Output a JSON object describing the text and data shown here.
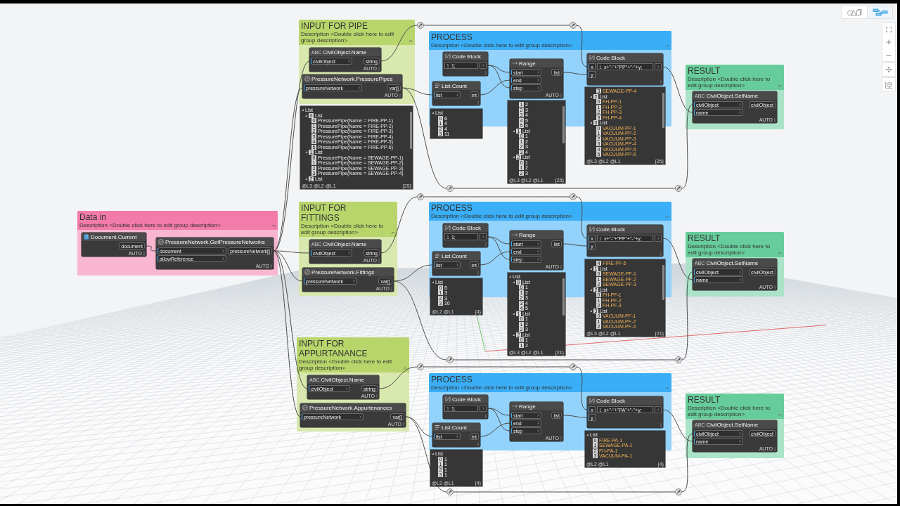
{
  "view_toggles": [
    {
      "selected": false
    },
    {
      "selected": true
    }
  ],
  "groups": [
    {
      "title": "Data in",
      "description": "Description <Double click here to edit group description>",
      "color": "#f27ba9",
      "nodes": [
        {
          "kind": "document",
          "title": "Document.Current",
          "outputs": [
            "document"
          ],
          "lacing": "AUTO"
        },
        {
          "kind": "network",
          "title": "PressureNetwork.GetPressureNetworks",
          "inputs": [
            "document",
            "allowReference"
          ],
          "outputs": [
            "pressureNetwork[]"
          ],
          "lacing": "AUTO"
        }
      ]
    },
    {
      "title": "INPUT FOR PIPE",
      "description": "Description <Double click here to edit group description>",
      "color": "#b8d56b",
      "nodes": [
        {
          "kind": "name",
          "icon_text": "ABC",
          "title": "CivilObject.Name",
          "inputs": [
            "civilObject"
          ],
          "outputs": [
            "string"
          ],
          "lacing": "AUTO"
        },
        {
          "kind": "network",
          "title": "PressureNetwork.PressurePipes",
          "inputs": [
            "pressureNetwork"
          ],
          "outputs": [
            "var[]"
          ],
          "lacing": "AUTO",
          "preview": {
            "kind": "objects",
            "items": [
              {
                "label": "List",
                "children": [
                  {
                    "index": "0",
                    "label": "List",
                    "children": [
                      {
                        "index": "0",
                        "value": "PressurePipe(Name = FIRE-PP-1)"
                      },
                      {
                        "index": "1",
                        "value": "PressurePipe(Name = FIRE-PP-2)"
                      },
                      {
                        "index": "2",
                        "value": "PressurePipe(Name = FIRE-PP-3)"
                      },
                      {
                        "index": "3",
                        "value": "PressurePipe(Name = FIRE-PP-4)"
                      },
                      {
                        "index": "4",
                        "value": "PressurePipe(Name = FIRE-PP-5)"
                      },
                      {
                        "index": "5",
                        "value": "PressurePipe(Name = FIRE-PP-6)"
                      }
                    ]
                  },
                  {
                    "index": "1",
                    "label": "List",
                    "children": [
                      {
                        "index": "0",
                        "value": "PressurePipe(Name = SEWAGE-PP-1)"
                      },
                      {
                        "index": "1",
                        "value": "PressurePipe(Name = SEWAGE-PP-2)"
                      },
                      {
                        "index": "2",
                        "value": "PressurePipe(Name = SEWAGE-PP-3)"
                      },
                      {
                        "index": "3",
                        "value": "PressurePipe(Name = SEWAGE-PP-4)"
                      }
                    ]
                  },
                  {
                    "index": "2",
                    "label": "List"
                  }
                ]
              }
            ],
            "levels": "@L3 @L2 @L1",
            "count": "{25}"
          }
        }
      ]
    },
    {
      "title": "PROCESS",
      "description": "Description <Double click here to edit group description>",
      "color": "#3aaef6",
      "nodes": [
        {
          "kind": "code",
          "title": "Code Block",
          "line": "1",
          "code": "1;"
        },
        {
          "kind": "count",
          "title": "List.Count",
          "inputs": [
            "list"
          ],
          "outputs": [
            "int"
          ],
          "preview": {
            "kind": "numbers",
            "items": [
              {
                "label": "List",
                "children": [
                  {
                    "index": "0",
                    "value": "6"
                  },
                  {
                    "index": "1",
                    "value": "4"
                  },
                  {
                    "index": "2",
                    "value": "4"
                  },
                  {
                    "index": "3",
                    "value": "11"
                  }
                ]
              }
            ]
          }
        },
        {
          "kind": "range",
          "title": "Range",
          "inputs": [
            "start",
            "end",
            "step"
          ],
          "outputs": [
            "list"
          ],
          "lacing": "AUTO",
          "preview": {
            "kind": "numbers",
            "items": [
              {
                "children": [
                  {
                    "children": [
                      {
                        "index": "1",
                        "value": "2"
                      },
                      {
                        "index": "2",
                        "value": "3"
                      },
                      {
                        "index": "3",
                        "value": "4"
                      },
                      {
                        "index": "4",
                        "value": "5"
                      },
                      {
                        "index": "5",
                        "value": "6"
                      }
                    ]
                  },
                  {
                    "index": "1",
                    "label": "List",
                    "children": [
                      {
                        "index": "0",
                        "value": "1"
                      },
                      {
                        "index": "1",
                        "value": "2"
                      },
                      {
                        "index": "2",
                        "value": "3"
                      },
                      {
                        "index": "3",
                        "value": "4"
                      }
                    ]
                  },
                  {
                    "index": "2",
                    "label": "List",
                    "children": [
                      {
                        "index": "0",
                        "value": "1"
                      },
                      {
                        "index": "1",
                        "value": "2"
                      },
                      {
                        "index": "2",
                        "value": "3"
                      }
                    ]
                  }
                ]
              }
            ],
            "levels": "@L3 @L2 @L1",
            "count": "{25}"
          }
        },
        {
          "kind": "code",
          "title": "Code Block",
          "inputs": [
            "x",
            "y"
          ],
          "line": "1",
          "code": "x+\"-\"+\"PP\"+\"-\"+y;",
          "preview": {
            "kind": "strings",
            "items": [
              {
                "children": [
                  {
                    "children": [
                      {
                        "index": "3",
                        "value": "SEWAGE-PP-4"
                      }
                    ]
                  },
                  {
                    "index": "2",
                    "label": "List",
                    "children": [
                      {
                        "index": "0",
                        "value": "FH-PP-1"
                      },
                      {
                        "index": "1",
                        "value": "FH-PP-2"
                      },
                      {
                        "index": "2",
                        "value": "FH-PP-3"
                      },
                      {
                        "index": "3",
                        "value": "FH-PP-4"
                      }
                    ]
                  },
                  {
                    "index": "3",
                    "label": "List",
                    "children": [
                      {
                        "index": "0",
                        "value": "VACUUM-PP-1"
                      },
                      {
                        "index": "1",
                        "value": "VACUUM-PP-2"
                      },
                      {
                        "index": "2",
                        "value": "VACUUM-PP-3"
                      },
                      {
                        "index": "3",
                        "value": "VACUUM-PP-4"
                      },
                      {
                        "index": "4",
                        "value": "VACUUM-PP-5"
                      },
                      {
                        "index": "5",
                        "value": "VACUUM-PP-6"
                      }
                    ]
                  }
                ]
              }
            ],
            "levels": "@L3 @L2 @L1",
            "count": "{25}"
          }
        }
      ]
    },
    {
      "title": "RESULT",
      "description": "Description <Double click here to edit group description>",
      "color": "#67cc9b",
      "nodes": [
        {
          "kind": "name",
          "icon_text": "ABC",
          "title": "CivilObject.SetName",
          "inputs": [
            "civilObject",
            "name"
          ],
          "outputs": [
            "civilObject"
          ],
          "lacing": "AUTO"
        }
      ]
    },
    {
      "title": "INPUT FOR FITTINGS",
      "description": "Description <Double click here to edit group description>",
      "color": "#b8d56b",
      "nodes": [
        {
          "kind": "name",
          "icon_text": "ABC",
          "title": "CivilObject.Name",
          "inputs": [
            "civilObject"
          ],
          "outputs": [
            "string"
          ],
          "lacing": "AUTO"
        },
        {
          "kind": "network",
          "title": "PressureNetwork.Fittings",
          "inputs": [
            "pressureNetwork"
          ],
          "outputs": [
            "var[]"
          ],
          "lacing": "AUTO"
        }
      ]
    },
    {
      "title": "PROCESS",
      "description": "Description <Double click here to edit group description>",
      "color": "#3aaef6",
      "nodes": [
        {
          "kind": "code",
          "title": "Code Block",
          "line": "1",
          "code": "1;"
        },
        {
          "kind": "count",
          "title": "List.Count",
          "inputs": [
            "list"
          ],
          "outputs": [
            "int"
          ],
          "preview": {
            "kind": "numbers",
            "items": [
              {
                "label": "List",
                "children": [
                  {
                    "index": "0",
                    "value": "5"
                  },
                  {
                    "index": "1",
                    "value": "3"
                  },
                  {
                    "index": "2",
                    "value": "3"
                  },
                  {
                    "index": "3",
                    "value": "10"
                  }
                ]
              }
            ],
            "levels": "@L2 @L1",
            "count": "{4}"
          }
        },
        {
          "kind": "range",
          "title": "Range",
          "inputs": [
            "start",
            "end",
            "step"
          ],
          "outputs": [
            "list"
          ],
          "lacing": "AUTO",
          "preview": {
            "kind": "numbers",
            "items": [
              {
                "label": "List",
                "children": [
                  {
                    "index": "0",
                    "label": "List",
                    "children": [
                      {
                        "index": "0",
                        "value": "1"
                      },
                      {
                        "index": "1",
                        "value": "2"
                      },
                      {
                        "index": "2",
                        "value": "3"
                      },
                      {
                        "index": "3",
                        "value": "4"
                      },
                      {
                        "index": "4",
                        "value": "5"
                      }
                    ]
                  },
                  {
                    "index": "1",
                    "label": "List",
                    "children": [
                      {
                        "index": "0",
                        "value": "1"
                      },
                      {
                        "index": "1",
                        "value": "2"
                      },
                      {
                        "index": "2",
                        "value": "3"
                      }
                    ]
                  },
                  {
                    "index": "2",
                    "label": "List",
                    "children": [
                      {
                        "index": "0",
                        "value": "1"
                      },
                      {
                        "index": "1",
                        "value": "2"
                      }
                    ]
                  }
                ]
              }
            ],
            "levels": "@L3 @L2 @L1",
            "count": "{21}"
          }
        },
        {
          "kind": "code",
          "title": "Code Block",
          "inputs": [
            "x",
            "y"
          ],
          "line": "1",
          "code": "x+\"-\"+\"PF\"+\"-\"+y;",
          "preview": {
            "kind": "strings",
            "items": [
              {
                "children": [
                  {
                    "children": [
                      {
                        "index": "4",
                        "value": "FIRE-PF-5"
                      }
                    ]
                  },
                  {
                    "index": "1",
                    "label": "List",
                    "children": [
                      {
                        "index": "0",
                        "value": "SEWAGE-PF-1"
                      },
                      {
                        "index": "1",
                        "value": "SEWAGE-PF-2"
                      },
                      {
                        "index": "2",
                        "value": "SEWAGE-PF-3"
                      }
                    ]
                  },
                  {
                    "index": "2",
                    "label": "List",
                    "children": [
                      {
                        "index": "0",
                        "value": "FH-PF-1"
                      },
                      {
                        "index": "1",
                        "value": "FH-PF-2"
                      },
                      {
                        "index": "2",
                        "value": "FH-PF-3"
                      }
                    ]
                  },
                  {
                    "index": "3",
                    "label": "List",
                    "children": [
                      {
                        "index": "0",
                        "value": "VACUUM-PF-1"
                      },
                      {
                        "index": "1",
                        "value": "VACUUM-PF-2"
                      },
                      {
                        "index": "2",
                        "value": "VACUUM-PF-3"
                      }
                    ]
                  }
                ]
              }
            ],
            "levels": "@L3 @L2 @L1",
            "count": "{21}"
          }
        }
      ]
    },
    {
      "title": "RESULT",
      "description": "Description <Double click here to edit group description>",
      "color": "#67cc9b",
      "nodes": [
        {
          "kind": "name",
          "icon_text": "ABC",
          "title": "CivilObject.SetName",
          "inputs": [
            "civilObject",
            "name"
          ],
          "outputs": [
            "civilObject"
          ],
          "lacing": "AUTO"
        }
      ]
    },
    {
      "title": "INPUT FOR APPURTANANCE",
      "description": "Description <Double click here to edit group description>",
      "color": "#b8d56b",
      "nodes": [
        {
          "kind": "name",
          "icon_text": "ABC",
          "title": "CivilObject.Name",
          "inputs": [
            "civilObject"
          ],
          "outputs": [
            "string"
          ],
          "lacing": "AUTO"
        },
        {
          "kind": "network",
          "title": "PressureNetwork.Appurtenances",
          "inputs": [
            "pressureNetwork"
          ],
          "outputs": [
            "var[]"
          ],
          "lacing": "AUTO"
        }
      ]
    },
    {
      "title": "PROCESS",
      "description": "Description <Double click here to edit group description>",
      "color": "#3aaef6",
      "nodes": [
        {
          "kind": "code",
          "title": "Code Block",
          "line": "1",
          "code": "1;"
        },
        {
          "kind": "count",
          "title": "List.Count",
          "inputs": [
            "list"
          ],
          "outputs": [
            "int"
          ],
          "preview": {
            "kind": "numbers",
            "items": [
              {
                "label": "List",
                "children": [
                  {
                    "index": "0",
                    "value": "1"
                  },
                  {
                    "index": "1",
                    "value": "1"
                  },
                  {
                    "index": "2",
                    "value": "1"
                  },
                  {
                    "index": "3",
                    "value": "1"
                  }
                ]
              }
            ],
            "levels": "@L2 @L1",
            "count": "{4}"
          }
        },
        {
          "kind": "range",
          "title": "Range",
          "inputs": [
            "start",
            "end",
            "step"
          ],
          "outputs": [
            "list"
          ],
          "lacing": "AUTO"
        },
        {
          "kind": "code",
          "title": "Code Block",
          "inputs": [
            "x",
            "y"
          ],
          "line": "1",
          "code": "x+\"-\"+\"PA\"+\"-\"+y;",
          "preview": {
            "kind": "strings",
            "items": [
              {
                "label": "List",
                "children": [
                  {
                    "index": "0",
                    "value": "FIRE-PA-1"
                  },
                  {
                    "index": "1",
                    "value": "SEWAGE-PA-1"
                  },
                  {
                    "index": "2",
                    "value": "FH-PA-1"
                  },
                  {
                    "index": "3",
                    "value": "VACUUM-PA-1"
                  }
                ]
              }
            ],
            "levels": "@L2 @L1",
            "count": "{4}"
          }
        }
      ]
    },
    {
      "title": "RESULT",
      "description": "Description <Double click here to edit group description>",
      "color": "#67cc9b",
      "nodes": [
        {
          "kind": "name",
          "icon_text": "ABC",
          "title": "CivilObject.SetName",
          "inputs": [
            "civilObject",
            "name"
          ],
          "outputs": [
            "civilObject"
          ],
          "lacing": "AUTO"
        }
      ]
    }
  ]
}
